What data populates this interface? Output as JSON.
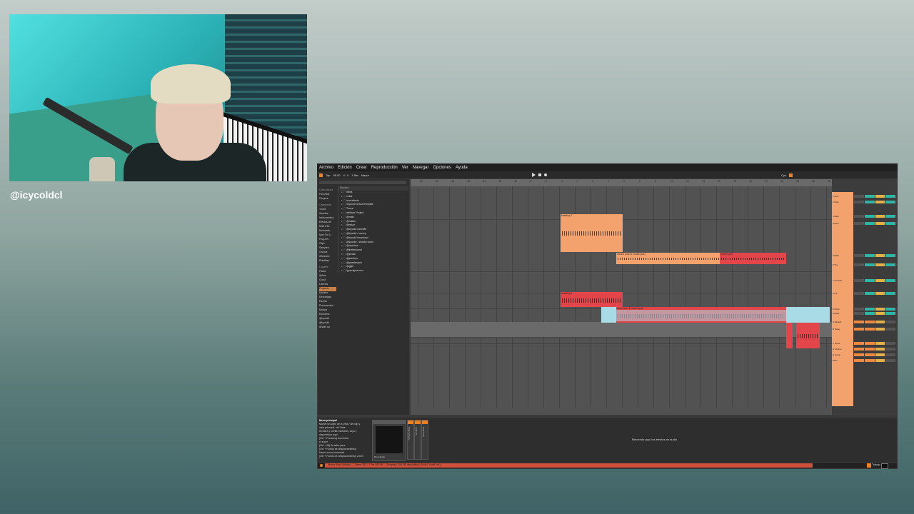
{
  "overlay": {
    "handle": "@icycoldcl"
  },
  "menu": [
    "Archivo",
    "Edición",
    "Crear",
    "Reproducción",
    "Ver",
    "Navegar",
    "Opciones",
    "Ayuda"
  ],
  "transport": {
    "tap": "Tap",
    "tempo": "96.00",
    "signature": "4 / 4",
    "quantize": "1 Bar",
    "key": "Mayor",
    "cpu": "Cpu"
  },
  "browser": {
    "collections_label": "Colecciones",
    "collections": [
      "Favoritos",
      "Púrpura"
    ],
    "categories_label": "Categorías",
    "categories": [
      "Todos",
      "Sonidos",
      "Instrumentos",
      "Efectos de",
      "MIDI Effe",
      "Modulado",
      "Max For Li",
      "Plug-Ins",
      "Clips",
      "Samples",
      "Groove",
      "Afinación",
      "Plantillas"
    ],
    "places_label": "Lugares",
    "places": [
      "Packs",
      "Splice",
      "Cloud",
      "Librería",
      "Proyecto",
      "Usuario",
      "Descargas",
      "Escrito",
      "Documentos",
      "Música",
      "Escritorio",
      "@icycold",
      "@icycold",
      "Añadir ca"
    ],
    "column_header": "Nombre",
    "files": [
      "ideas",
      "vetas",
      "love effects",
      "!icycold trvrsz2 template",
      "Tunes",
      "artifacts Project",
      "@maiz",
      "@nullas",
      "@nylon",
      "@icycold cancelle",
      "@icycold v mercy",
      "@icycold incantoud",
      "@icycold - shubby loone",
      "@nyochos",
      "@thebeyound",
      "@jordan",
      "@juantres",
      "@pnealerquin",
      "@ggle",
      "!jquentyoa muo"
    ]
  },
  "ruler": [
    "-22",
    "-20",
    "-18",
    "-16",
    "-14",
    "-12",
    "-10",
    "-8",
    "-6",
    "-4",
    "-2",
    "0",
    "2",
    "4",
    "6",
    "8",
    "10",
    "12",
    "14",
    "16",
    "18",
    "20",
    "22",
    "24",
    "26",
    "28",
    "30"
  ],
  "clips": [
    {
      "title": "beatdrop 1"
    },
    {
      "title": "vocal 2 (ooiz) 1 vocals (ooz)"
    },
    {
      "title": "vocal 2 (oo)"
    },
    {
      "title": "beatdrop 2"
    },
    {
      "title": "vocal (ooz) 1 (vocal-eyes)"
    },
    {
      "title": ""
    }
  ],
  "tracks": [
    "1 Kick",
    "2 Clap",
    "3 Hats",
    "4 Perc",
    "5 Bass",
    "6 Vox",
    "7 Vox Dbl",
    "8 FX",
    "9 Chop",
    "10 Bell",
    "A Reverb",
    "B Delay",
    "C Send",
    "D Chorus",
    "E Group",
    "Main"
  ],
  "detail": {
    "info_title": "Menú principal",
    "info_lines": [
      "Mueve los clips de la vista / del clip y",
      "vista principal. ctrl Vista",
      "Arrastra y suelta muestras, clips y",
      "dispositivos aquí.",
      "",
      "[Ctrl + Presiona] Aumentar",
      "el zoom",
      "[Ctrl + Alt] Arrastra para",
      "[Ctrl + Rueda de desplazamiento]",
      "Hacer zoom horizontal",
      "[Ctrl + Rueda de desplazamiento] Zoom"
    ],
    "device_name": "Drum Rack",
    "channels": [
      "Chain Volume",
      "Audio To",
      "Chain Pan"
    ],
    "drop_hint": "Recorrido aquí los efectos de audio"
  },
  "status": {
    "message": "Nuevo disco iniciado — Antes: 352.1 / Pre-MP4 B — Después: 364 KB dispositivos (Audio 'Vocal Ver')",
    "right_label": "Trabajo"
  }
}
